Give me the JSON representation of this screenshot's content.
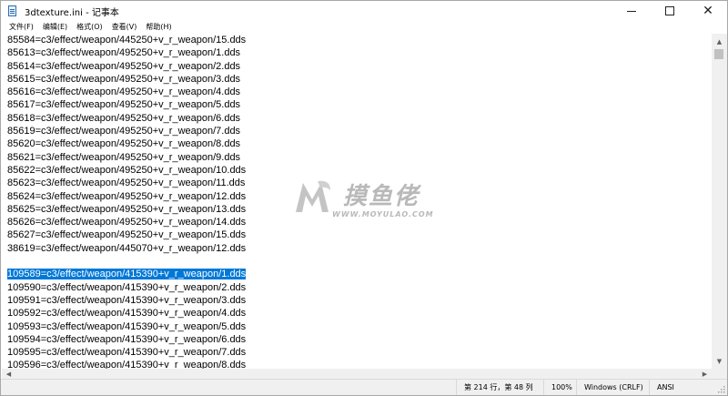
{
  "window": {
    "title": "3dtexture.ini - 记事本",
    "minimize_glyph": "",
    "maximize_glyph": "",
    "close_glyph": "✕"
  },
  "menu": [
    {
      "label": "文件(F)"
    },
    {
      "label": "编辑(E)"
    },
    {
      "label": "格式(O)"
    },
    {
      "label": "查看(V)"
    },
    {
      "label": "帮助(H)"
    }
  ],
  "editor": {
    "lines": [
      "85584=c3/effect/weapon/445250+v_r_weapon/15.dds",
      "85613=c3/effect/weapon/495250+v_r_weapon/1.dds",
      "85614=c3/effect/weapon/495250+v_r_weapon/2.dds",
      "85615=c3/effect/weapon/495250+v_r_weapon/3.dds",
      "85616=c3/effect/weapon/495250+v_r_weapon/4.dds",
      "85617=c3/effect/weapon/495250+v_r_weapon/5.dds",
      "85618=c3/effect/weapon/495250+v_r_weapon/6.dds",
      "85619=c3/effect/weapon/495250+v_r_weapon/7.dds",
      "85620=c3/effect/weapon/495250+v_r_weapon/8.dds",
      "85621=c3/effect/weapon/495250+v_r_weapon/9.dds",
      "85622=c3/effect/weapon/495250+v_r_weapon/10.dds",
      "85623=c3/effect/weapon/495250+v_r_weapon/11.dds",
      "85624=c3/effect/weapon/495250+v_r_weapon/12.dds",
      "85625=c3/effect/weapon/495250+v_r_weapon/13.dds",
      "85626=c3/effect/weapon/495250+v_r_weapon/14.dds",
      "85627=c3/effect/weapon/495250+v_r_weapon/15.dds",
      "38619=c3/effect/weapon/445070+v_r_weapon/12.dds",
      "",
      "109589=c3/effect/weapon/415390+v_r_weapon/1.dds",
      "109590=c3/effect/weapon/415390+v_r_weapon/2.dds",
      "109591=c3/effect/weapon/415390+v_r_weapon/3.dds",
      "109592=c3/effect/weapon/415390+v_r_weapon/4.dds",
      "109593=c3/effect/weapon/415390+v_r_weapon/5.dds",
      "109594=c3/effect/weapon/415390+v_r_weapon/6.dds",
      "109595=c3/effect/weapon/415390+v_r_weapon/7.dds",
      "109596=c3/effect/weapon/415390+v_r_weapon/8.dds"
    ],
    "selected_line_index": 18,
    "selection_color": "#0078d7"
  },
  "statusbar": {
    "position": "第 214 行，第 48 列",
    "zoom": "100%",
    "line_ending": "Windows (CRLF)",
    "encoding": "ANSI"
  },
  "watermark": {
    "name": "摸鱼佬",
    "domain": "WWW.MOYULAO.COM"
  },
  "icons": {
    "app": "notepad-icon",
    "scroll_up": "▲",
    "scroll_down": "▼",
    "scroll_left": "◀",
    "scroll_right": "▶"
  }
}
